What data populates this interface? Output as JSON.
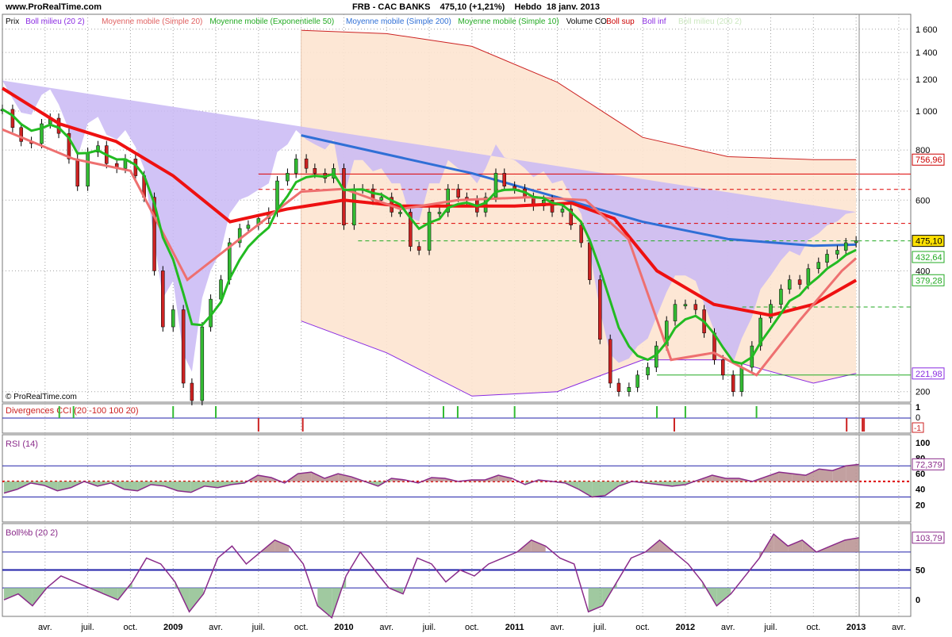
{
  "site": "www.ProRealTime.com",
  "header": {
    "symbol": "FRB - CAC BANKS",
    "last_change": "475,10 (+1,21%)",
    "period": "Hebdo",
    "date": "18 janv. 2013"
  },
  "copyright": "© ProRealTime.com",
  "legend": [
    {
      "text": "Prix",
      "color": "#000000"
    },
    {
      "text": "Boll milieu (20 2)",
      "color": "#8a2be2"
    },
    {
      "text": "Moyenne mobile (Simple 20)",
      "color": "#e06060"
    },
    {
      "text": "Moyenne mobile (Exponentielle 50)",
      "color": "#22aa22"
    },
    {
      "text": "Moyenne mobile (Simple 200)",
      "color": "#2f6fd6"
    },
    {
      "text": "Moyenne mobile (Simple 10)",
      "color": "#22aa22"
    },
    {
      "text": "Volume CO",
      "color": "#000000"
    },
    {
      "text": "Boll sup",
      "color": "#cc0000"
    },
    {
      "text": "Boll inf",
      "color": "#8a2be2"
    },
    {
      "text": "Boll milieu (200 2)",
      "color": "#cce8c0"
    }
  ],
  "colors": {
    "up": "#33bb33",
    "down": "#cc2222",
    "sma20": "#ee7070",
    "sma50": "#ee1111",
    "ema": "#22bb22",
    "sma200": "#2f6fd6",
    "boll20": "#c9b8f4",
    "boll200": "#fde4d0",
    "rsi": "#8a2b8a",
    "grid": "#a0a0a0"
  },
  "x_labels": [
    "avr.",
    "juil.",
    "oct.",
    "2009",
    "avr.",
    "juil.",
    "oct.",
    "2010",
    "avr.",
    "juil.",
    "oct.",
    "2011",
    "avr.",
    "juil.",
    "oct.",
    "2012",
    "avr.",
    "juil.",
    "oct.",
    "2013",
    "avr."
  ],
  "x_bold": [
    false,
    false,
    false,
    true,
    false,
    false,
    false,
    true,
    false,
    false,
    false,
    true,
    false,
    false,
    false,
    true,
    false,
    false,
    false,
    true,
    false
  ],
  "chart_data": [
    {
      "type": "line",
      "title": "FRB - CAC BANKS",
      "xlabel": "",
      "ylabel": "",
      "x_range": [
        "2008-01",
        "2013-05"
      ],
      "ylim": [
        190,
        1650
      ],
      "y_ticks": [
        "200",
        "400",
        "600",
        "800",
        "1 000",
        "1 200",
        "1 400",
        "1 600"
      ],
      "price_labels": [
        {
          "label": "756,96",
          "value": 757,
          "color": "#cc0000"
        },
        {
          "label": "475,10",
          "value": 475,
          "color": "#000000",
          "bg": "#ffe100"
        },
        {
          "label": "432,64",
          "value": 433,
          "color": "#22aa22"
        },
        {
          "label": "379,28",
          "value": 379,
          "color": "#22aa22"
        },
        {
          "label": "221,98",
          "value": 222,
          "color": "#8a2be2"
        }
      ],
      "horizontal_lines": [
        {
          "value": 697,
          "color": "#dd0000",
          "style": "solid",
          "from": "2009-07"
        },
        {
          "value": 638,
          "color": "#dd0000",
          "style": "dashed",
          "from": "2009-07"
        },
        {
          "value": 525,
          "color": "#dd0000",
          "style": "dashed",
          "from": "2009-07"
        },
        {
          "value": 475,
          "color": "#22aa22",
          "style": "dashed",
          "from": "2010-02"
        },
        {
          "value": 325,
          "color": "#22aa22",
          "style": "dashed",
          "from": "2012-05"
        },
        {
          "value": 220,
          "color": "#22aa22",
          "style": "solid",
          "from": "2011-11"
        }
      ],
      "price": {
        "t": [
          0,
          0.06,
          0.11,
          0.17,
          0.23,
          0.28,
          0.33,
          0.39,
          0.44,
          0.5,
          0.56,
          0.61,
          0.67,
          0.72,
          0.78,
          0.83,
          0.89,
          0.94,
          1.0,
          1.06,
          1.11,
          1.17,
          1.22,
          1.28,
          1.33,
          1.39,
          1.44,
          1.5,
          1.56,
          1.61,
          1.67,
          1.72,
          1.78,
          1.83,
          1.89,
          1.94,
          2.0,
          2.06,
          2.11,
          2.17,
          2.22,
          2.28,
          2.33,
          2.39,
          2.44,
          2.5,
          2.56,
          2.61,
          2.67,
          2.72,
          2.78,
          2.83,
          2.89,
          2.94,
          3.0,
          3.06,
          3.11,
          3.17,
          3.22,
          3.28,
          3.33,
          3.39,
          3.44,
          3.5,
          3.56,
          3.61,
          3.67,
          3.72,
          3.78,
          3.83,
          3.89,
          3.94,
          4.0,
          4.06,
          4.11,
          4.17,
          4.22,
          4.28,
          4.33,
          4.39,
          4.44,
          4.5,
          4.56,
          4.61,
          4.67,
          4.72,
          4.78,
          4.83,
          4.89,
          4.94,
          5.0,
          5.06
        ],
        "v": [
          1010,
          910,
          840,
          830,
          930,
          960,
          880,
          760,
          650,
          790,
          820,
          740,
          720,
          760,
          690,
          610,
          400,
          290,
          320,
          210,
          190,
          290,
          340,
          380,
          470,
          510,
          520,
          540,
          560,
          670,
          700,
          760,
          720,
          700,
          680,
          720,
          520,
          640,
          640,
          600,
          610,
          560,
          560,
          460,
          450,
          560,
          560,
          640,
          610,
          600,
          560,
          610,
          700,
          650,
          640,
          610,
          580,
          600,
          560,
          570,
          520,
          470,
          380,
          270,
          210,
          200,
          205,
          220,
          230,
          260,
          300,
          330,
          330,
          320,
          280,
          240,
          220,
          200,
          230,
          260,
          305,
          330,
          360,
          380,
          370,
          405,
          420,
          440,
          450,
          470,
          475
        ]
      },
      "sma20_dates": [
        "2008-01",
        "2008-06",
        "2008-10",
        "2009-02",
        "2009-06",
        "2009-10",
        "2010-01",
        "2010-05",
        "2010-09",
        "2011-02",
        "2011-06",
        "2011-09",
        "2011-12",
        "2012-03",
        "2012-06",
        "2012-09",
        "2012-12",
        "2013-01"
      ],
      "sma20_values": [
        900,
        760,
        710,
        380,
        490,
        630,
        640,
        570,
        600,
        610,
        600,
        480,
        240,
        250,
        220,
        300,
        400,
        430
      ],
      "sma50_dates": [
        "2008-01",
        "2008-05",
        "2008-09",
        "2009-01",
        "2009-05",
        "2009-09",
        "2010-01",
        "2010-05",
        "2010-09",
        "2011-01",
        "2011-05",
        "2011-08",
        "2011-11",
        "2012-03",
        "2012-07",
        "2012-10",
        "2013-01"
      ],
      "sma50_values": [
        1140,
        930,
        840,
        690,
        530,
        570,
        600,
        580,
        580,
        580,
        590,
        540,
        400,
        330,
        310,
        330,
        379
      ],
      "ema_values_note": "Moyenne mobile (Exponentielle 50)",
      "sma200_dates": [
        "2009-10",
        "2010-04",
        "2010-10",
        "2011-04",
        "2011-10",
        "2012-04",
        "2012-10",
        "2013-01"
      ],
      "sma200_values": [
        870,
        780,
        700,
        610,
        530,
        480,
        462,
        465
      ],
      "boll200_upper": [
        1590,
        1560,
        1450,
        1180,
        860,
        770,
        757,
        757
      ],
      "boll200_lower": [
        300,
        250,
        195,
        200,
        240,
        240,
        210,
        222
      ],
      "boll200_dates": [
        "2009-10",
        "2010-04",
        "2010-10",
        "2011-04",
        "2011-10",
        "2012-04",
        "2012-10",
        "2013-01"
      ]
    },
    {
      "type": "bar",
      "title": "Divergences CCI (20 -100 100 20)",
      "y_ticks": [
        "1",
        "0",
        "-1"
      ],
      "bull_signals": [
        "2008-05",
        "2008-06",
        "2009-01",
        "2009-04",
        "2010-08",
        "2010-09",
        "2011-01",
        "2011-11",
        "2012-01",
        "2012-06"
      ],
      "bear_signals": [
        "2009-07",
        "2009-10",
        "2011-12",
        "2012-12",
        "2013-01",
        "2013-01"
      ],
      "label_value": "-1"
    },
    {
      "type": "line",
      "title": "RSI (14)",
      "ylim": [
        0,
        100
      ],
      "y_ticks": [
        "100",
        "80",
        "60",
        "40",
        "20"
      ],
      "levels": [
        30,
        50,
        70
      ],
      "last_label": "72,379",
      "values": [
        35,
        40,
        48,
        45,
        38,
        42,
        50,
        44,
        48,
        40,
        38,
        46,
        44,
        38,
        36,
        44,
        42,
        46,
        48,
        58,
        55,
        48,
        60,
        62,
        54,
        60,
        56,
        50,
        44,
        54,
        52,
        48,
        55,
        54,
        50,
        52,
        52,
        58,
        54,
        46,
        52,
        50,
        48,
        40,
        30,
        32,
        44,
        50,
        48,
        46,
        44,
        46,
        52,
        58,
        54,
        54,
        50,
        56,
        62,
        60,
        58,
        66,
        64,
        70,
        72
      ]
    },
    {
      "type": "line",
      "title": "Boll%b (20 2)",
      "ylim": [
        -25,
        125
      ],
      "y_ticks": [
        "100",
        "50",
        "0"
      ],
      "levels": [
        20,
        50,
        80
      ],
      "last_label": "103,79",
      "values": [
        0,
        10,
        -10,
        20,
        40,
        30,
        20,
        10,
        0,
        30,
        70,
        60,
        30,
        -20,
        10,
        70,
        90,
        60,
        80,
        100,
        90,
        60,
        -10,
        -30,
        40,
        80,
        50,
        20,
        10,
        70,
        60,
        30,
        50,
        40,
        60,
        70,
        80,
        100,
        90,
        70,
        60,
        -20,
        -10,
        30,
        70,
        80,
        100,
        80,
        60,
        30,
        -10,
        10,
        40,
        70,
        110,
        90,
        100,
        80,
        90,
        100,
        104
      ]
    }
  ]
}
